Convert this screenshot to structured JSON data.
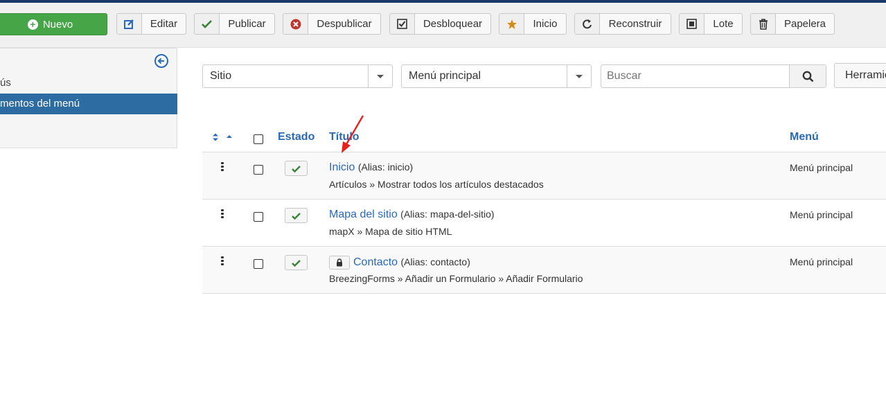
{
  "toolbar": {
    "new_label": "Nuevo",
    "buttons": [
      {
        "label": "Editar",
        "icon": "edit-icon"
      },
      {
        "label": "Publicar",
        "icon": "check-icon"
      },
      {
        "label": "Despublicar",
        "icon": "unpublish-icon"
      },
      {
        "label": "Desbloquear",
        "icon": "checkbox-icon"
      },
      {
        "label": "Inicio",
        "icon": "star-icon"
      },
      {
        "label": "Reconstruir",
        "icon": "refresh-icon"
      },
      {
        "label": "Lote",
        "icon": "batch-icon"
      },
      {
        "label": "Papelera",
        "icon": "trash-icon"
      }
    ]
  },
  "sidebar": {
    "items": [
      {
        "label": "ús"
      },
      {
        "label": "mentos del menú",
        "active": true
      }
    ]
  },
  "filters": {
    "client": "Sitio",
    "menu": "Menú principal",
    "search_placeholder": "Buscar",
    "search_value": "",
    "tools_label": "Herramientas"
  },
  "table": {
    "headers": {
      "status": "Estado",
      "title": "Título",
      "menu": "Menú"
    },
    "rows": [
      {
        "title": "Inicio",
        "alias": "(Alias: inicio)",
        "type": "Artículos » Mostrar todos los artículos destacados",
        "menu": "Menú principal",
        "locked": false
      },
      {
        "title": "Mapa del sitio",
        "alias": "(Alias: mapa-del-sitio)",
        "type": "mapX » Mapa de sitio HTML",
        "menu": "Menú principal",
        "locked": false
      },
      {
        "title": "Contacto",
        "alias": "(Alias: contacto)",
        "type": "BreezingForms » Añadir un Formulario » Añadir Formulario",
        "menu": "Menú principal",
        "locked": true
      }
    ]
  },
  "colors": {
    "accent": "#2a69b8",
    "new_button": "#46a546",
    "sidebar_active": "#2d6ca2",
    "annotation_arrow": "#e8201c"
  }
}
